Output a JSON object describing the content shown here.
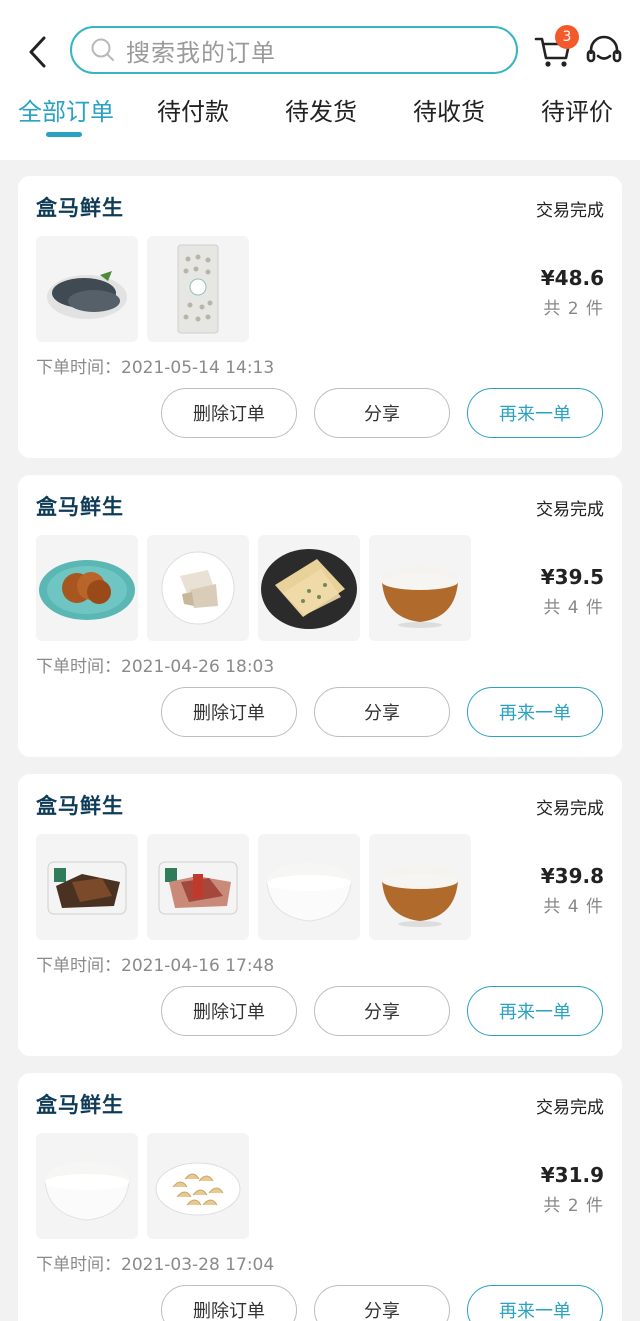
{
  "header": {
    "search_placeholder": "搜索我的订单",
    "cart_badge": "3"
  },
  "tabs": [
    "全部订单",
    "待付款",
    "待发货",
    "待收货",
    "待评价"
  ],
  "orders": [
    {
      "store": "盒马鲜生",
      "status": "交易完成",
      "price": "¥48.6",
      "count": "共 2 件",
      "time": "下单时间：2021-05-14 14:13",
      "items": [
        "fish",
        "pack"
      ],
      "actions": {
        "delete": "删除订单",
        "share": "分享",
        "reorder": "再来一单"
      }
    },
    {
      "store": "盒马鲜生",
      "status": "交易完成",
      "price": "¥39.5",
      "count": "共 4 件",
      "time": "下单时间：2021-04-26 18:03",
      "items": [
        "braised-plate",
        "chicken-plate",
        "pancake-plate",
        "rice-wood-bowl"
      ],
      "actions": {
        "delete": "删除订单",
        "share": "分享",
        "reorder": "再来一单"
      }
    },
    {
      "store": "盒马鲜生",
      "status": "交易完成",
      "price": "¥39.8",
      "count": "共 4 件",
      "time": "下单时间：2021-04-16 17:48",
      "items": [
        "tray-dark",
        "tray-meat",
        "rice-white-bowl",
        "rice-wood-bowl"
      ],
      "actions": {
        "delete": "删除订单",
        "share": "分享",
        "reorder": "再来一单"
      }
    },
    {
      "store": "盒马鲜生",
      "status": "交易完成",
      "price": "¥31.9",
      "count": "共 2 件",
      "time": "下单时间：2021-03-28 17:04",
      "items": [
        "rice-white-bowl",
        "cashew-plate"
      ],
      "actions": {
        "delete": "删除订单",
        "share": "分享",
        "reorder": "再来一单"
      }
    }
  ],
  "colors": {
    "accent": "#2aa2c2",
    "store_name": "#0e3b57",
    "badge": "#f4592b"
  },
  "icons": [
    "back-icon",
    "search-icon",
    "cart-icon",
    "customer-service-icon"
  ]
}
